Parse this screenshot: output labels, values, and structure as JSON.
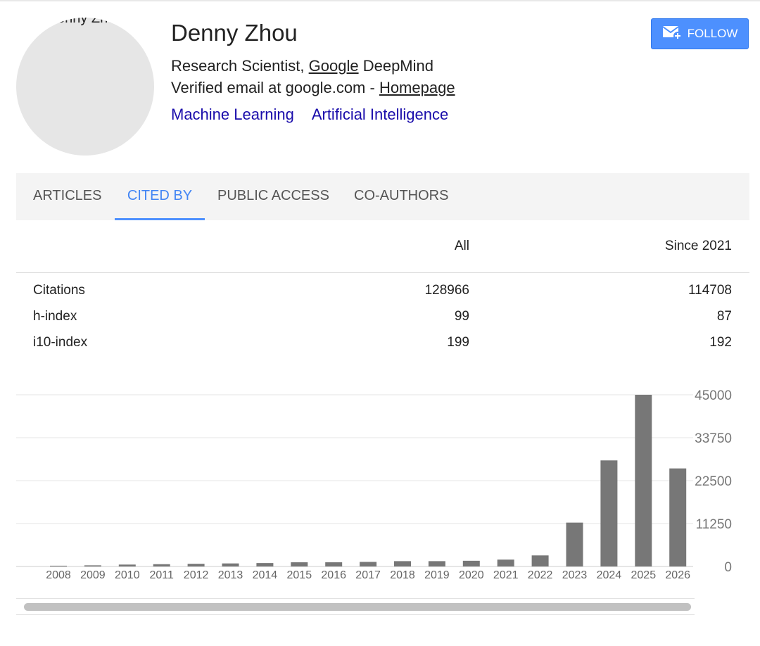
{
  "profile": {
    "avatar_alt": "Denny Zhou",
    "name": "Denny Zhou",
    "affiliation_prefix": "Research Scientist, ",
    "affiliation_link": "Google",
    "affiliation_suffix": " DeepMind",
    "email_text": "Verified email at google.com - ",
    "homepage_link": "Homepage",
    "interests": [
      "Machine Learning",
      "Artificial Intelligence"
    ],
    "follow_label": "FOLLOW",
    "follow_icon": "envelope-plus-icon"
  },
  "tabs": [
    {
      "label": "ARTICLES",
      "active": false
    },
    {
      "label": "CITED BY",
      "active": true
    },
    {
      "label": "PUBLIC ACCESS",
      "active": false
    },
    {
      "label": "CO-AUTHORS",
      "active": false
    }
  ],
  "stats": {
    "headers": {
      "label": "",
      "all": "All",
      "since": "Since 2021"
    },
    "rows": [
      {
        "label": "Citations",
        "all": "128966",
        "since": "114708"
      },
      {
        "label": "h-index",
        "all": "99",
        "since": "87"
      },
      {
        "label": "i10-index",
        "all": "199",
        "since": "192"
      }
    ]
  },
  "colors": {
    "accent": "#4285f4",
    "bar": "#777777",
    "link": "#1a0dab",
    "button": "#4d90fe"
  },
  "chart_data": {
    "type": "bar",
    "categories": [
      "2008",
      "2009",
      "2010",
      "2011",
      "2012",
      "2013",
      "2014",
      "2015",
      "2016",
      "2017",
      "2018",
      "2019",
      "2020",
      "2021",
      "2022",
      "2023",
      "2024",
      "2025",
      "2026"
    ],
    "values": [
      200,
      300,
      500,
      600,
      700,
      800,
      900,
      1100,
      1100,
      1200,
      1400,
      1400,
      1500,
      1800,
      2900,
      11500,
      27800,
      45000,
      25700
    ],
    "ylim": [
      0,
      45000
    ],
    "yticks": [
      "0",
      "11250",
      "22500",
      "33750",
      "45000"
    ],
    "title": "",
    "xlabel": "",
    "ylabel": "",
    "grid": true,
    "y_axis_side": "right"
  }
}
